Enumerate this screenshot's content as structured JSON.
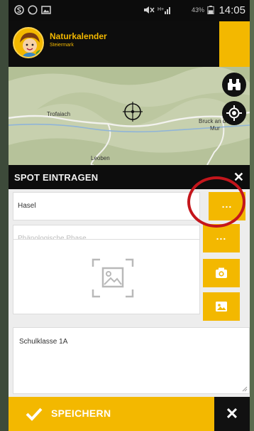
{
  "status_bar": {
    "battery": "43%",
    "time": "14:05"
  },
  "header": {
    "title": "Naturkalender",
    "subtitle": "Steiermark"
  },
  "map": {
    "places": [
      "Trofaiach",
      "Bruck an der",
      "Mur",
      "Leoben"
    ]
  },
  "panel": {
    "title": "SPOT EINTRAGEN"
  },
  "form": {
    "species_value": "Hasel",
    "phase_placeholder": "Phänologische Phase",
    "note_value": "Schulklasse 1A"
  },
  "footer": {
    "save_label": "SPEICHERN"
  },
  "colors": {
    "accent": "#f3b800",
    "dark": "#0d0d0d",
    "annotation": "#c4161c"
  }
}
